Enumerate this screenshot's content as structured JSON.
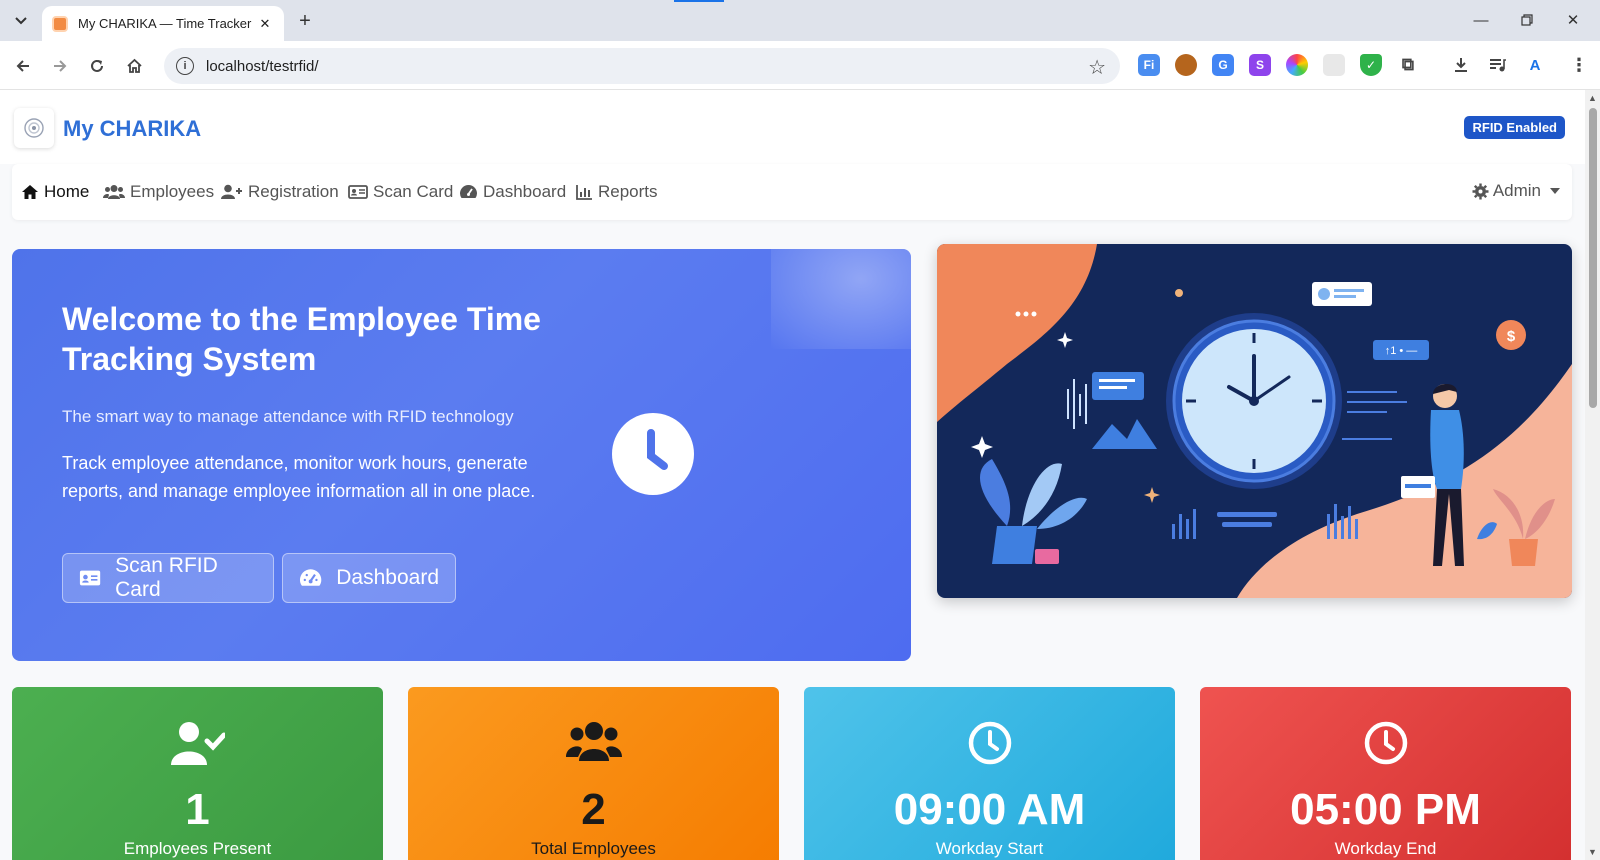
{
  "browser": {
    "tab_title": "My CHARIKA — Time Tracker",
    "url": "localhost/testrfid/",
    "extensions": [
      "Fi",
      "cookie-icon",
      "translate-icon",
      "S",
      "color-icon",
      "blank-icon",
      "shield-icon",
      "puzzle-icon"
    ],
    "accent": "#1a73e8"
  },
  "header": {
    "brand": "My CHARIKA",
    "badge": "RFID Enabled"
  },
  "nav": {
    "items": [
      {
        "label": "Home",
        "icon": "home-icon"
      },
      {
        "label": "Employees",
        "icon": "users-icon"
      },
      {
        "label": "Registration",
        "icon": "user-plus-icon"
      },
      {
        "label": "Scan Card",
        "icon": "id-card-icon"
      },
      {
        "label": "Dashboard",
        "icon": "gauge-icon"
      },
      {
        "label": "Reports",
        "icon": "bar-chart-icon"
      }
    ],
    "admin": "Admin"
  },
  "hero": {
    "title": "Welcome to the Employee Time Tracking System",
    "subtitle": "The smart way to manage attendance with RFID technology",
    "description": "Track employee attendance, monitor work hours, generate reports, and manage employee information all in one place.",
    "buttons": {
      "scan": "Scan RFID Card",
      "dashboard": "Dashboard"
    }
  },
  "illustration": {
    "badge_text": "↑1 • —"
  },
  "stats": [
    {
      "value": "1",
      "label": "Employees Present",
      "color": "#43a047"
    },
    {
      "value": "2",
      "label": "Total Employees",
      "color": "#fb8c00"
    },
    {
      "value": "09:00 AM",
      "label": "Workday Start",
      "color": "#29b6e6"
    },
    {
      "value": "05:00 PM",
      "label": "Workday End",
      "color": "#e53935"
    }
  ]
}
